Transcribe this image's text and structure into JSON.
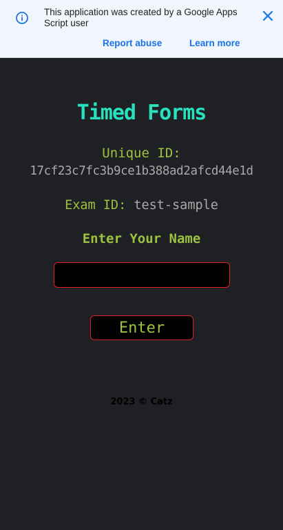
{
  "banner": {
    "message": "This application was created by a Google Apps Script user",
    "report_label": "Report abuse",
    "learn_label": "Learn more",
    "info_icon": "info-icon",
    "close_icon": "close-icon"
  },
  "app": {
    "title": "Timed Forms",
    "unique_id_label": "Unique ID:",
    "unique_id_value": "17cf23c7fc3b9ce1b388ad2afcd44e1d",
    "exam_id_label": "Exam ID:",
    "exam_id_value": "test-sample",
    "name_heading": "Enter Your Name",
    "name_value": "",
    "enter_label": "Enter",
    "footer": "2023 © Catz"
  },
  "colors": {
    "background": "#1e2024",
    "title": "#27e1bf",
    "label_green": "#9dc240",
    "value_gray": "#a9a9a9",
    "border_red": "#e0202a",
    "banner_bg": "#f1f5fc",
    "link_blue": "#1a73e8"
  }
}
